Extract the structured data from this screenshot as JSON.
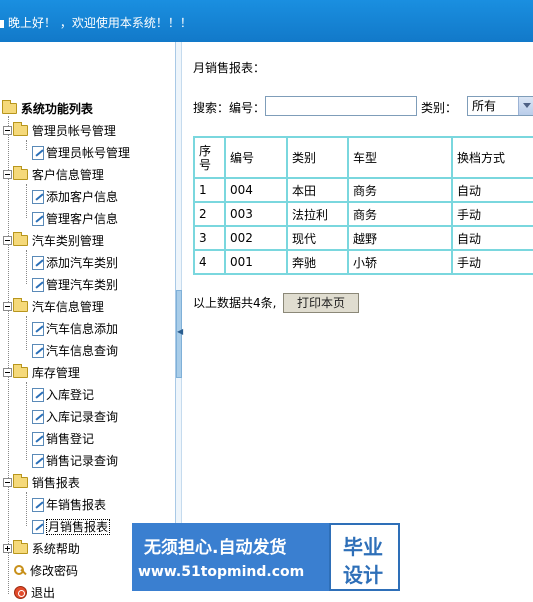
{
  "header": {
    "welcome": "晚上好！ ，欢迎使用本系统！！！"
  },
  "sidebar": {
    "root_label": "系统功能列表",
    "groups": [
      {
        "label": "管理员帐号管理",
        "items": [
          "管理员帐号管理"
        ]
      },
      {
        "label": "客户信息管理",
        "items": [
          "添加客户信息",
          "管理客户信息"
        ]
      },
      {
        "label": "汽车类别管理",
        "items": [
          "添加汽车类别",
          "管理汽车类别"
        ]
      },
      {
        "label": "汽车信息管理",
        "items": [
          "汽车信息添加",
          "汽车信息查询"
        ]
      },
      {
        "label": "库存管理",
        "items": [
          "入库登记",
          "入库记录查询",
          "销售登记",
          "销售记录查询"
        ]
      },
      {
        "label": "销售报表",
        "items": [
          "年销售报表",
          "月销售报表"
        ]
      },
      {
        "label": "系统帮助",
        "items": []
      }
    ],
    "change_password": "修改密码",
    "logout": "退出"
  },
  "main": {
    "title": "月销售报表：",
    "search": {
      "label": "搜索：",
      "code_label": "编号：",
      "code_value": "",
      "type_label": "类别：",
      "type_selected": "所有"
    },
    "table": {
      "headers": [
        "序号",
        "编号",
        "类别",
        "车型",
        "换档方式"
      ],
      "rows": [
        [
          "1",
          "004",
          "本田",
          "商务",
          "自动"
        ],
        [
          "2",
          "003",
          "法拉利",
          "商务",
          "手动"
        ],
        [
          "3",
          "002",
          "现代",
          "越野",
          "自动"
        ],
        [
          "4",
          "001",
          "奔驰",
          "小轿",
          "手动"
        ]
      ]
    },
    "summary": "以上数据共4条,",
    "print_button": "打印本页"
  },
  "watermark": {
    "line1": "无须担心.自动发货",
    "line2": "www.51topmind.com",
    "right1": "毕业",
    "right2": "设计"
  }
}
